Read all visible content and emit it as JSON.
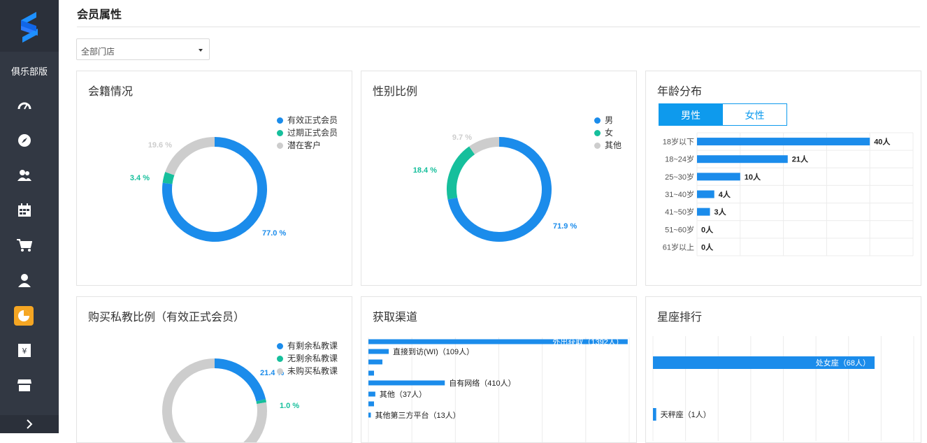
{
  "sidebar": {
    "edition": "俱乐部版",
    "icons": [
      "dashboard-icon",
      "compass-icon",
      "members-icon",
      "calendar-icon",
      "cart-icon",
      "user-icon",
      "pie-chart-icon",
      "yen-icon",
      "store-icon"
    ],
    "active_color": "#f5a623"
  },
  "header": {
    "title": "会员属性"
  },
  "filter": {
    "store_select": "全部门店"
  },
  "colors": {
    "blue": "#1b8ceb",
    "green": "#16bf9c",
    "gray": "#cdcdcd"
  },
  "membership": {
    "title": "会籍情况",
    "legend": [
      "有效正式会员",
      "过期正式会员",
      "潜在客户"
    ]
  },
  "gender": {
    "title": "性别比例",
    "legend": [
      "男",
      "女",
      "其他"
    ]
  },
  "age": {
    "title": "年龄分布",
    "tabs": [
      "男性",
      "女性"
    ]
  },
  "private_coach": {
    "title": "购买私教比例（有效正式会员）",
    "legend": [
      "有剩余私教课",
      "无剩余私教课",
      "未购买私教课"
    ]
  },
  "channel": {
    "title": "获取渠道"
  },
  "zodiac": {
    "title": "星座排行"
  },
  "chart_data": [
    {
      "type": "pie",
      "categories": [
        "有效正式会员",
        "过期正式会员",
        "潜在客户"
      ],
      "values": [
        77.0,
        3.4,
        19.6
      ],
      "labels": [
        "77.0 %",
        "3.4 %",
        "19.6 %"
      ]
    },
    {
      "type": "pie",
      "categories": [
        "男",
        "女",
        "其他"
      ],
      "values": [
        71.9,
        18.4,
        9.7
      ],
      "labels": [
        "71.9 %",
        "18.4 %",
        "9.7 %"
      ]
    },
    {
      "type": "bar",
      "orientation": "horizontal",
      "categories": [
        "18岁以下",
        "18~24岁",
        "25~30岁",
        "31~40岁",
        "41~50岁",
        "51~60岁",
        "61岁以上"
      ],
      "values": [
        40,
        21,
        10,
        4,
        3,
        0,
        0
      ],
      "labels": [
        "40人",
        "21人",
        "10人",
        "4人",
        "3人",
        "0人",
        "0人"
      ],
      "xlim": [
        0,
        50
      ],
      "grid": true
    },
    {
      "type": "pie",
      "categories": [
        "有剩余私教课",
        "无剩余私教课",
        "未购买私教课"
      ],
      "values": [
        21.4,
        1.0,
        77.6
      ],
      "labels": [
        "21.4 %",
        "1.0 %",
        ""
      ]
    },
    {
      "type": "bar",
      "orientation": "horizontal",
      "categories": [
        "外出获取",
        "直接到访(WI)",
        "",
        "",
        "自有网络",
        "其他",
        "",
        "其他第三方平台"
      ],
      "values": [
        1392,
        109,
        75,
        30,
        410,
        37,
        30,
        13
      ],
      "labels": [
        "外出获取（1392人）",
        "直接到访(WI)（109人）",
        "",
        "",
        "自有网络（410人）",
        "其他（37人）",
        "",
        "其他第三方平台（13人）"
      ],
      "xlim": [
        0,
        1400
      ],
      "grid": true
    },
    {
      "type": "bar",
      "orientation": "horizontal",
      "categories": [
        "处女座",
        "天秤座"
      ],
      "values": [
        68,
        1
      ],
      "labels": [
        "处女座（68人）",
        "天秤座（1人）"
      ],
      "xlim": [
        0,
        80
      ],
      "grid": true
    }
  ]
}
